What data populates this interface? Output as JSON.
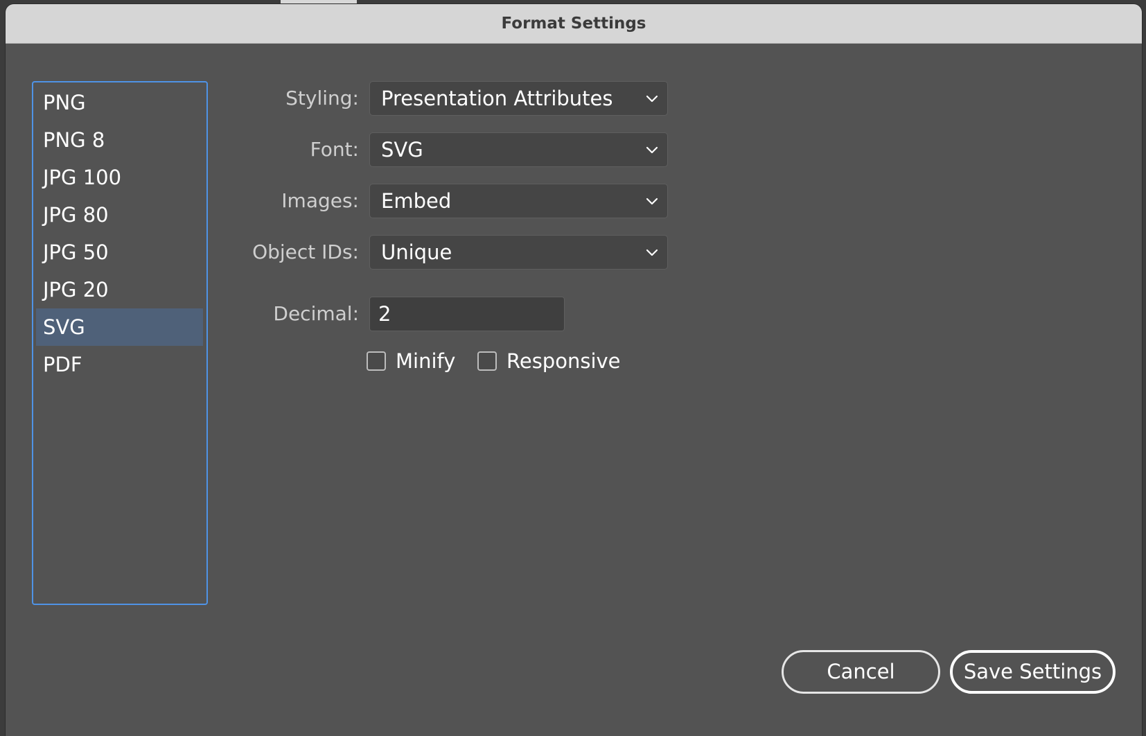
{
  "dialog": {
    "title": "Format Settings"
  },
  "formats": {
    "items": [
      "PNG",
      "PNG 8",
      "JPG 100",
      "JPG 80",
      "JPG 50",
      "JPG 20",
      "SVG",
      "PDF"
    ],
    "selected": "SVG"
  },
  "settings": {
    "styling": {
      "label": "Styling:",
      "value": "Presentation Attributes"
    },
    "font": {
      "label": "Font:",
      "value": "SVG"
    },
    "images": {
      "label": "Images:",
      "value": "Embed"
    },
    "object_ids": {
      "label": "Object IDs:",
      "value": "Unique"
    },
    "decimal": {
      "label": "Decimal:",
      "value": "2"
    },
    "minify": {
      "label": "Minify",
      "checked": false
    },
    "responsive": {
      "label": "Responsive",
      "checked": false
    }
  },
  "buttons": {
    "cancel": "Cancel",
    "save": "Save Settings"
  },
  "colors": {
    "dialog_bg": "#535353",
    "titlebar_bg": "#d6d6d6",
    "list_border": "#4f93e6",
    "selected_bg": "#4f6179"
  }
}
